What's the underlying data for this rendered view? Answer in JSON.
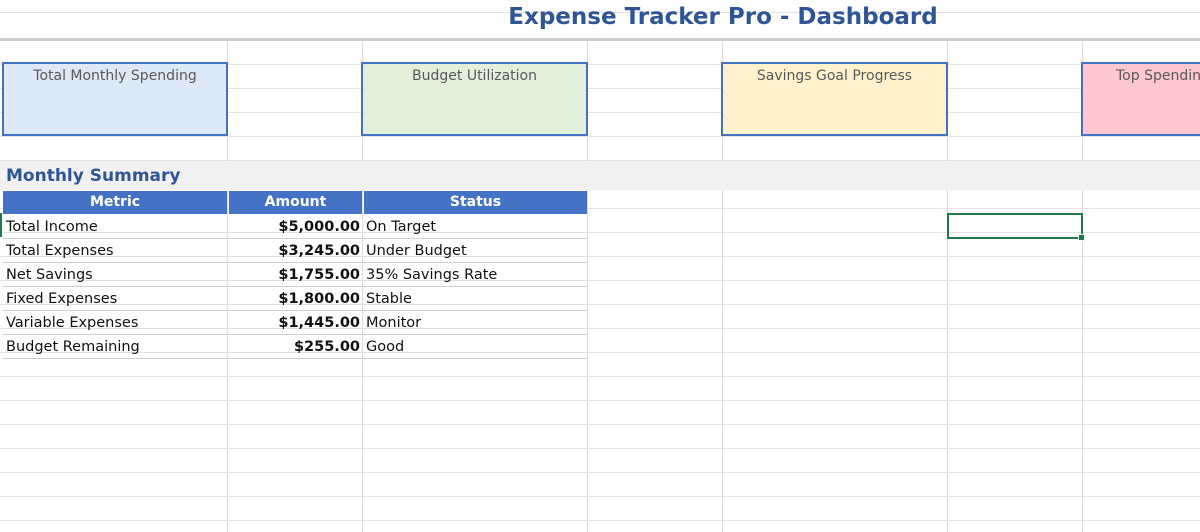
{
  "title": "Expense Tracker Pro - Dashboard",
  "kpi_cards": [
    {
      "label": "Total Monthly Spending",
      "bg": "#dde9f6"
    },
    {
      "label": "Budget Utilization",
      "bg": "#e2efda"
    },
    {
      "label": "Savings Goal Progress",
      "bg": "#fff2cc"
    },
    {
      "label": "Top Spending",
      "bg": "#ffc7ce"
    }
  ],
  "section": {
    "title": "Monthly Summary"
  },
  "table": {
    "headers": [
      "Metric",
      "Amount",
      "Status"
    ],
    "rows": [
      {
        "metric": "Total Income",
        "amount": "$5,000.00",
        "status": "On Target"
      },
      {
        "metric": "Total Expenses",
        "amount": "$3,245.00",
        "status": "Under Budget"
      },
      {
        "metric": "Net Savings",
        "amount": "$1,755.00",
        "status": "35% Savings Rate"
      },
      {
        "metric": "Fixed Expenses",
        "amount": "$1,800.00",
        "status": "Stable"
      },
      {
        "metric": "Variable Expenses",
        "amount": "$1,445.00",
        "status": "Monitor"
      },
      {
        "metric": "Budget Remaining",
        "amount": "$255.00",
        "status": "Good"
      }
    ]
  },
  "colors": {
    "accent": "#4472c4",
    "title": "#2f5597",
    "selection": "#1f7a4d"
  }
}
